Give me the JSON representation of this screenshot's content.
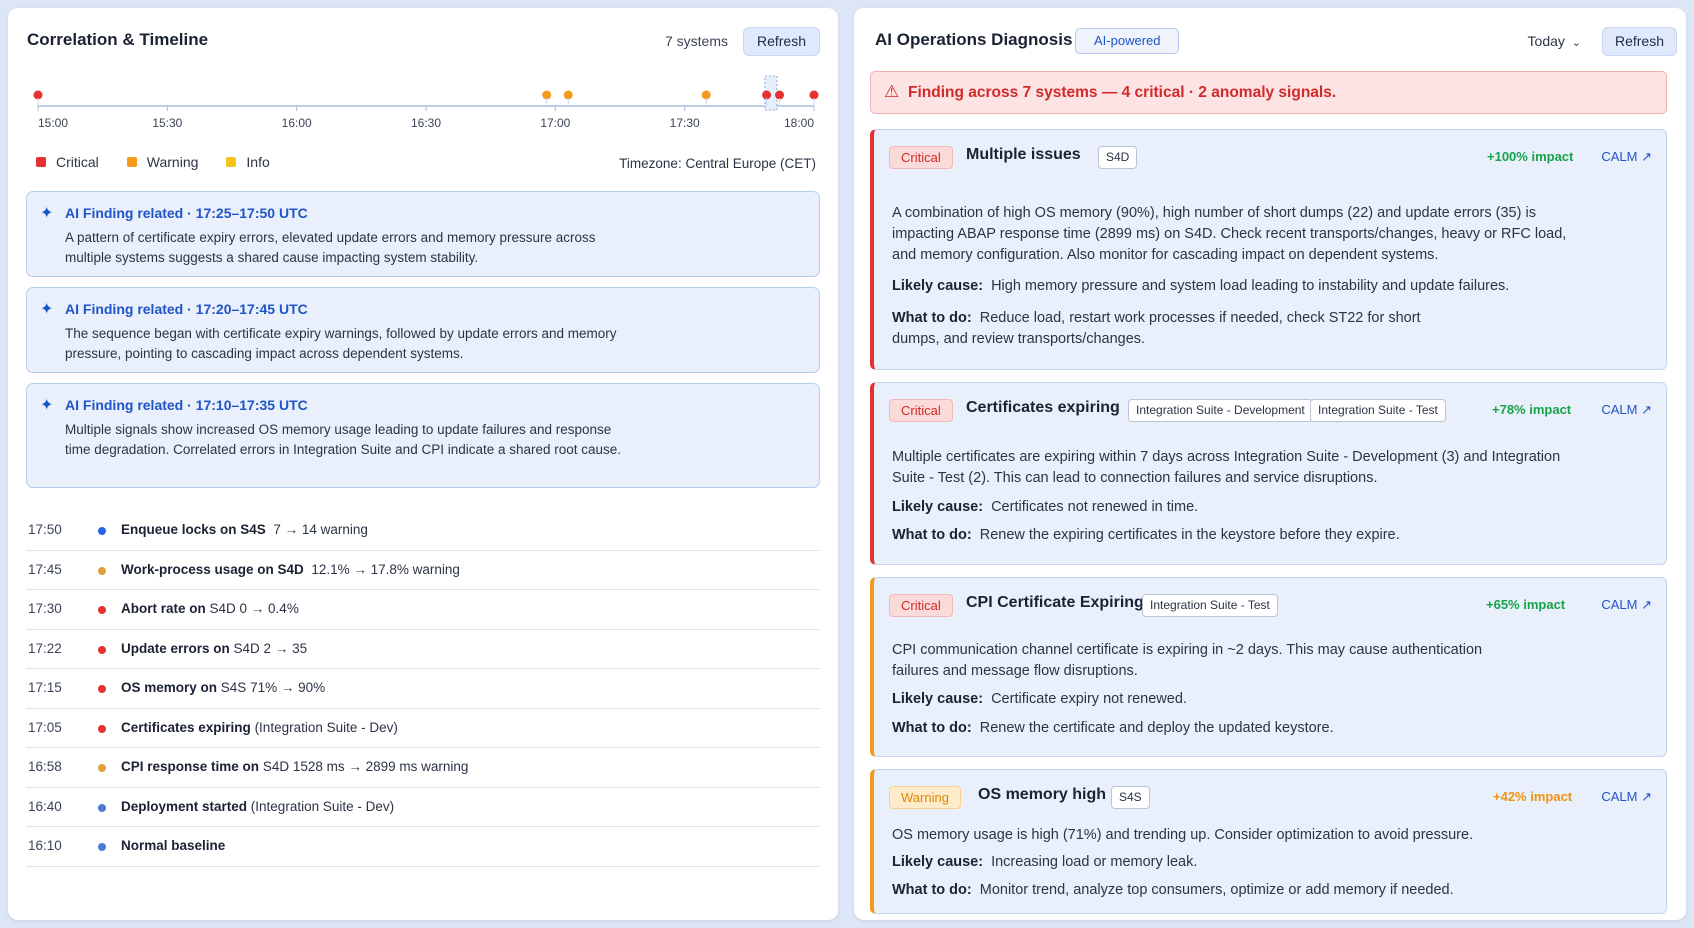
{
  "left": {
    "title": "Correlation & Timeline",
    "systems_count": "7 systems",
    "refresh_label": "Refresh",
    "timezone": "Timezone: Central Europe (CET)",
    "timeline": {
      "start_minutes": 0,
      "end_minutes": 180,
      "ticks": [
        "15:00",
        "15:30",
        "16:00",
        "16:30",
        "17:00",
        "17:30",
        "18:00"
      ],
      "markers": [
        {
          "time": "15:00",
          "severity": "critical"
        },
        {
          "time": "16:58",
          "severity": "warning"
        },
        {
          "time": "17:03",
          "severity": "warning"
        },
        {
          "time": "17:35",
          "severity": "warning"
        },
        {
          "time": "17:49",
          "severity": "critical"
        },
        {
          "time": "17:52",
          "severity": "critical"
        },
        {
          "time": "18:00",
          "severity": "critical"
        }
      ],
      "highlight": "17:50"
    },
    "legend": [
      {
        "label": "Critical",
        "color": "#e53131"
      },
      {
        "label": "Warning",
        "color": "#f39a1a"
      },
      {
        "label": "Info",
        "color": "#f5c518"
      }
    ],
    "findings": [
      {
        "head": "AI Finding related · 17:25–17:50 UTC",
        "body": "A pattern of certificate expiry errors, elevated update errors and memory pressure across multiple systems suggests a shared cause impacting system stability."
      },
      {
        "head": "AI Finding related · 17:20–17:45 UTC",
        "body": "The sequence began with certificate expiry warnings, followed by update errors and memory pressure, pointing to cascading impact across dependent systems."
      },
      {
        "head": "AI Finding related · 17:10–17:35 UTC",
        "body": "Multiple signals show increased OS memory usage leading to update failures and response time degradation. Correlated errors in Integration Suite and CPI indicate a shared root cause."
      }
    ],
    "events": [
      {
        "time": "17:50",
        "dot": "#2563eb",
        "bold": "Enqueue locks on S4S",
        "rest": "7 → 14  warning"
      },
      {
        "time": "17:45",
        "dot": "#e0a040",
        "bold": "Work-process usage on S4D",
        "rest": "12.1% → 17.8%  warning"
      },
      {
        "time": "17:30",
        "dot": "#e53131",
        "bold": "Abort rate on",
        "rest": "S4D  0 → 0.4%"
      },
      {
        "time": "17:22",
        "dot": "#e53131",
        "bold": "Update errors on",
        "rest": "S4D  2 → 35"
      },
      {
        "time": "17:15",
        "dot": "#e53131",
        "bold": "OS memory on",
        "rest": "S4S  71% → 90%"
      },
      {
        "time": "17:05",
        "dot": "#e53131",
        "bold": "Certificates expiring",
        "rest": "(Integration Suite - Dev)"
      },
      {
        "time": "16:58",
        "dot": "#e0a040",
        "bold": "CPI response time  on",
        "rest": "S4D  1528 ms → 2899 ms  warning"
      },
      {
        "time": "16:40",
        "dot": "#4a7bd6",
        "bold": "Deployment started",
        "rest": "(Integration Suite - Dev)"
      },
      {
        "time": "16:10",
        "dot": "#4a7bd6",
        "bold": "Normal baseline",
        "rest": ""
      }
    ]
  },
  "right": {
    "title": "AI Operations Diagnosis",
    "ai_badge": "AI-powered",
    "period": "Today",
    "refresh_label": "Refresh",
    "alert": "Finding across 7 systems — 4 critical · 2 anomaly signals.",
    "cards": [
      {
        "severity": "Critical",
        "title": "Multiple issues",
        "tags": [
          "S4D"
        ],
        "impact": "+100% impact",
        "calm": "CALM ↗",
        "description": "A combination of high OS memory (90%), high number of short dumps (22) and update errors (35) is impacting ABAP response time (2899 ms) on S4D. Check recent transports/changes, heavy or RFC load, and memory configuration. Also monitor for cascading impact on dependent systems.",
        "cause_label": "Likely cause:",
        "cause": "High memory pressure and system load leading to instability and update failures.",
        "todo_label": "What to do:",
        "todo": "Reduce load, restart work processes if needed, check ST22 for short dumps, and review transports/changes."
      },
      {
        "severity": "Critical",
        "title": "Certificates expiring",
        "tags": [
          "Integration Suite - Development",
          "Integration Suite - Test"
        ],
        "impact": "+78% impact",
        "calm": "CALM ↗",
        "description": "Multiple certificates are expiring within 7 days across Integration Suite - Development (3) and Integration Suite - Test (2). This can lead to connection failures and service disruptions.",
        "cause_label": "Likely cause:",
        "cause": "Certificates not renewed in time.",
        "todo_label": "What to do:",
        "todo": "Renew the expiring certificates in the keystore before they expire."
      },
      {
        "severity": "Critical",
        "title": "CPI Certificate Expiring",
        "tags": [
          "Integration Suite - Test"
        ],
        "impact": "+65% impact",
        "calm": "CALM ↗",
        "description": "CPI communication channel certificate is expiring in ~2 days. This may cause authentication failures and message flow disruptions.",
        "cause_label": "Likely cause:",
        "cause": "Certificate expiry not renewed.",
        "todo_label": "What to do:",
        "todo": "Renew the certificate and deploy the updated keystore."
      },
      {
        "severity": "Warning",
        "title": "OS memory high",
        "tags": [
          "S4S"
        ],
        "impact": "+42% impact",
        "calm": "CALM ↗",
        "description": "OS memory usage is high (71%) and trending up. Consider optimization to avoid pressure.",
        "cause_label": "Likely cause:",
        "cause": "Increasing load or memory leak.",
        "todo_label": "What to do:",
        "todo": "Monitor trend, analyze top consumers, optimize or add memory if needed."
      }
    ]
  }
}
